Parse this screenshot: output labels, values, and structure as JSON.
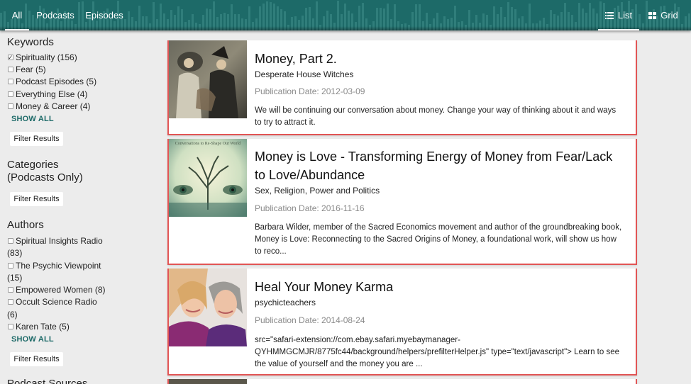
{
  "nav": {
    "tabs": [
      {
        "label": "All",
        "active": true
      },
      {
        "label": "Podcasts",
        "active": false
      },
      {
        "label": "Episodes",
        "active": false
      }
    ],
    "views": [
      {
        "label": "List",
        "icon": "list-icon",
        "active": true
      },
      {
        "label": "Grid",
        "icon": "grid-icon",
        "active": false
      }
    ]
  },
  "sidebar": {
    "keywords": {
      "title": "Keywords",
      "items": [
        {
          "label": "Spirituality (156)",
          "checked": true
        },
        {
          "label": "Fear (5)",
          "checked": false
        },
        {
          "label": "Podcast Episodes (5)",
          "checked": false
        },
        {
          "label": "Everything Else (4)",
          "checked": false
        },
        {
          "label": "Money & Career (4)",
          "checked": false
        }
      ],
      "show_all": "SHOW ALL",
      "filter": "Filter Results"
    },
    "categories": {
      "title_line1": "Categories",
      "title_line2": "(Podcasts Only)",
      "filter": "Filter Results"
    },
    "authors": {
      "title": "Authors",
      "items": [
        {
          "label": "Spiritual Insights Radio",
          "count": "(83)"
        },
        {
          "label": "The Psychic Viewpoint",
          "count": "(15)"
        },
        {
          "label": "Empowered Women (8)",
          "count": ""
        },
        {
          "label": "Occult Science Radio",
          "count": "(6)"
        },
        {
          "label": "Karen Tate (5)",
          "count": ""
        }
      ],
      "show_all": "SHOW ALL",
      "filter": "Filter Results"
    },
    "podcast_sources": {
      "title": "Podcast Sources"
    }
  },
  "results": [
    {
      "title": "Money, Part 2.",
      "podcast": "Desperate House Witches",
      "date": "Publication Date: 2012-03-09",
      "description": "We will be continuing our conversation about money. Change your way of thinking about it and ways to try to attract it."
    },
    {
      "title": "Money is Love - Transforming Energy of Money from Fear/Lack to Love/Abundance",
      "podcast": "Sex, Religion, Power and Politics",
      "date": "Publication Date: 2016-11-16",
      "description": "Barbara Wilder, member of the Sacred Economics movement and author of the groundbreaking book, Money is Love: Reconnecting to the Sacred Origins of Money, a foundational work, will show us how to reco...",
      "thumb_caption": "Conversations to Re-Shape Our World"
    },
    {
      "title": "Heal Your Money Karma",
      "podcast": "psychicteachers",
      "date": "Publication Date: 2014-08-24",
      "description": "src=\"safari-extension://com.ebay.safari.myebaymanager-QYHMMGCMJR/8775fc44/background/helpers/prefilterHelper.js\" type=\"text/javascript\"> Learn to see the value of yourself and the money you are ..."
    }
  ],
  "colors": {
    "header": "#1d6a68",
    "accent": "#1d6a68",
    "card_border": "#e25555",
    "background": "#ececec"
  }
}
